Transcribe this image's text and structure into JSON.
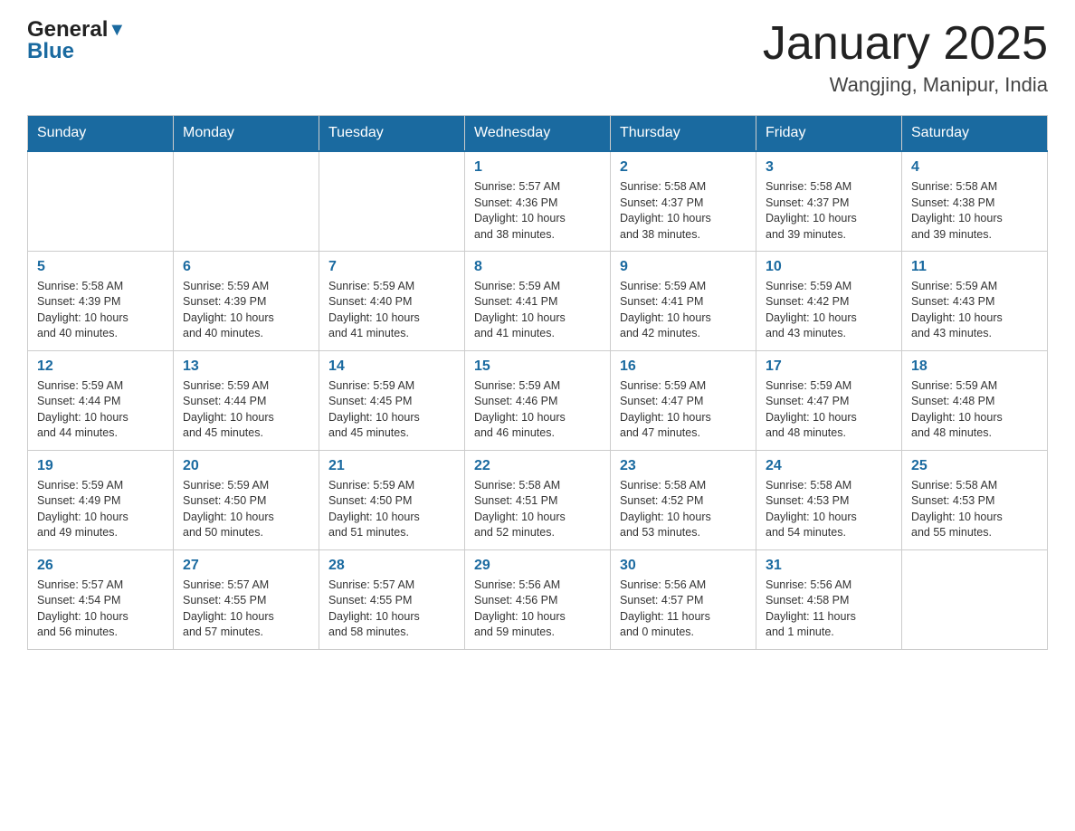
{
  "header": {
    "title": "January 2025",
    "subtitle": "Wangjing, Manipur, India",
    "logo_general": "General",
    "logo_blue": "Blue"
  },
  "days_of_week": [
    "Sunday",
    "Monday",
    "Tuesday",
    "Wednesday",
    "Thursday",
    "Friday",
    "Saturday"
  ],
  "weeks": [
    [
      {
        "num": "",
        "info": ""
      },
      {
        "num": "",
        "info": ""
      },
      {
        "num": "",
        "info": ""
      },
      {
        "num": "1",
        "info": "Sunrise: 5:57 AM\nSunset: 4:36 PM\nDaylight: 10 hours\nand 38 minutes."
      },
      {
        "num": "2",
        "info": "Sunrise: 5:58 AM\nSunset: 4:37 PM\nDaylight: 10 hours\nand 38 minutes."
      },
      {
        "num": "3",
        "info": "Sunrise: 5:58 AM\nSunset: 4:37 PM\nDaylight: 10 hours\nand 39 minutes."
      },
      {
        "num": "4",
        "info": "Sunrise: 5:58 AM\nSunset: 4:38 PM\nDaylight: 10 hours\nand 39 minutes."
      }
    ],
    [
      {
        "num": "5",
        "info": "Sunrise: 5:58 AM\nSunset: 4:39 PM\nDaylight: 10 hours\nand 40 minutes."
      },
      {
        "num": "6",
        "info": "Sunrise: 5:59 AM\nSunset: 4:39 PM\nDaylight: 10 hours\nand 40 minutes."
      },
      {
        "num": "7",
        "info": "Sunrise: 5:59 AM\nSunset: 4:40 PM\nDaylight: 10 hours\nand 41 minutes."
      },
      {
        "num": "8",
        "info": "Sunrise: 5:59 AM\nSunset: 4:41 PM\nDaylight: 10 hours\nand 41 minutes."
      },
      {
        "num": "9",
        "info": "Sunrise: 5:59 AM\nSunset: 4:41 PM\nDaylight: 10 hours\nand 42 minutes."
      },
      {
        "num": "10",
        "info": "Sunrise: 5:59 AM\nSunset: 4:42 PM\nDaylight: 10 hours\nand 43 minutes."
      },
      {
        "num": "11",
        "info": "Sunrise: 5:59 AM\nSunset: 4:43 PM\nDaylight: 10 hours\nand 43 minutes."
      }
    ],
    [
      {
        "num": "12",
        "info": "Sunrise: 5:59 AM\nSunset: 4:44 PM\nDaylight: 10 hours\nand 44 minutes."
      },
      {
        "num": "13",
        "info": "Sunrise: 5:59 AM\nSunset: 4:44 PM\nDaylight: 10 hours\nand 45 minutes."
      },
      {
        "num": "14",
        "info": "Sunrise: 5:59 AM\nSunset: 4:45 PM\nDaylight: 10 hours\nand 45 minutes."
      },
      {
        "num": "15",
        "info": "Sunrise: 5:59 AM\nSunset: 4:46 PM\nDaylight: 10 hours\nand 46 minutes."
      },
      {
        "num": "16",
        "info": "Sunrise: 5:59 AM\nSunset: 4:47 PM\nDaylight: 10 hours\nand 47 minutes."
      },
      {
        "num": "17",
        "info": "Sunrise: 5:59 AM\nSunset: 4:47 PM\nDaylight: 10 hours\nand 48 minutes."
      },
      {
        "num": "18",
        "info": "Sunrise: 5:59 AM\nSunset: 4:48 PM\nDaylight: 10 hours\nand 48 minutes."
      }
    ],
    [
      {
        "num": "19",
        "info": "Sunrise: 5:59 AM\nSunset: 4:49 PM\nDaylight: 10 hours\nand 49 minutes."
      },
      {
        "num": "20",
        "info": "Sunrise: 5:59 AM\nSunset: 4:50 PM\nDaylight: 10 hours\nand 50 minutes."
      },
      {
        "num": "21",
        "info": "Sunrise: 5:59 AM\nSunset: 4:50 PM\nDaylight: 10 hours\nand 51 minutes."
      },
      {
        "num": "22",
        "info": "Sunrise: 5:58 AM\nSunset: 4:51 PM\nDaylight: 10 hours\nand 52 minutes."
      },
      {
        "num": "23",
        "info": "Sunrise: 5:58 AM\nSunset: 4:52 PM\nDaylight: 10 hours\nand 53 minutes."
      },
      {
        "num": "24",
        "info": "Sunrise: 5:58 AM\nSunset: 4:53 PM\nDaylight: 10 hours\nand 54 minutes."
      },
      {
        "num": "25",
        "info": "Sunrise: 5:58 AM\nSunset: 4:53 PM\nDaylight: 10 hours\nand 55 minutes."
      }
    ],
    [
      {
        "num": "26",
        "info": "Sunrise: 5:57 AM\nSunset: 4:54 PM\nDaylight: 10 hours\nand 56 minutes."
      },
      {
        "num": "27",
        "info": "Sunrise: 5:57 AM\nSunset: 4:55 PM\nDaylight: 10 hours\nand 57 minutes."
      },
      {
        "num": "28",
        "info": "Sunrise: 5:57 AM\nSunset: 4:55 PM\nDaylight: 10 hours\nand 58 minutes."
      },
      {
        "num": "29",
        "info": "Sunrise: 5:56 AM\nSunset: 4:56 PM\nDaylight: 10 hours\nand 59 minutes."
      },
      {
        "num": "30",
        "info": "Sunrise: 5:56 AM\nSunset: 4:57 PM\nDaylight: 11 hours\nand 0 minutes."
      },
      {
        "num": "31",
        "info": "Sunrise: 5:56 AM\nSunset: 4:58 PM\nDaylight: 11 hours\nand 1 minute."
      },
      {
        "num": "",
        "info": ""
      }
    ]
  ]
}
